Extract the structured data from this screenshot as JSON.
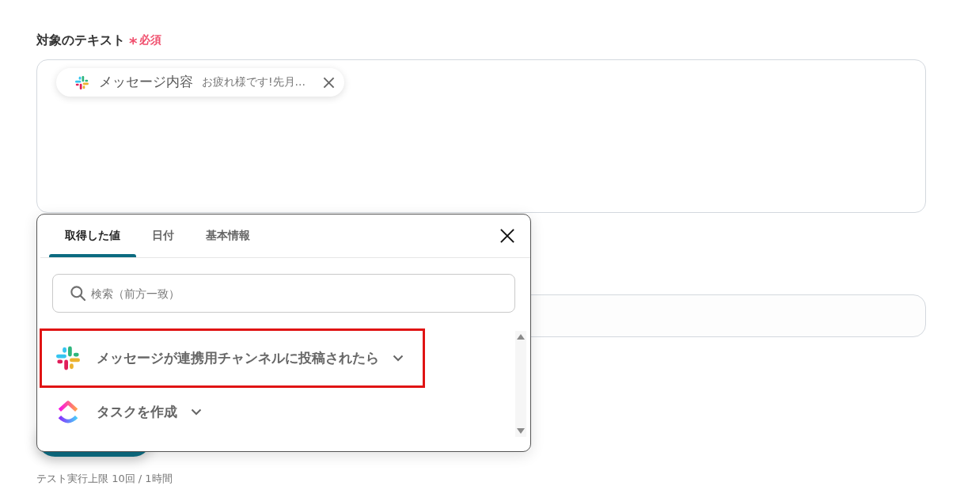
{
  "text_field": {
    "label": "対象のテキスト",
    "required": {
      "mark": "*",
      "label": "必須"
    },
    "chips": [
      {
        "kind": "message",
        "name": "メッセージ内容",
        "value": "お疲れ様です!先月..."
      }
    ]
  },
  "limit_note": "テスト実行上限 10回 / 1時間",
  "picker": {
    "tabs": [
      {
        "label": "取得した値",
        "selected": true
      },
      {
        "label": "日付",
        "selected": false
      },
      {
        "label": "基本情報",
        "selected": false
      }
    ],
    "search": {
      "placeholder": "検索（前方一致）"
    },
    "items": [
      {
        "kind": "message",
        "label": "メッセージが連携用チャンネルに投稿されたら",
        "highlighted": true
      },
      {
        "kind": "task",
        "label": "タスクを作成",
        "highlighted": false
      }
    ]
  }
}
